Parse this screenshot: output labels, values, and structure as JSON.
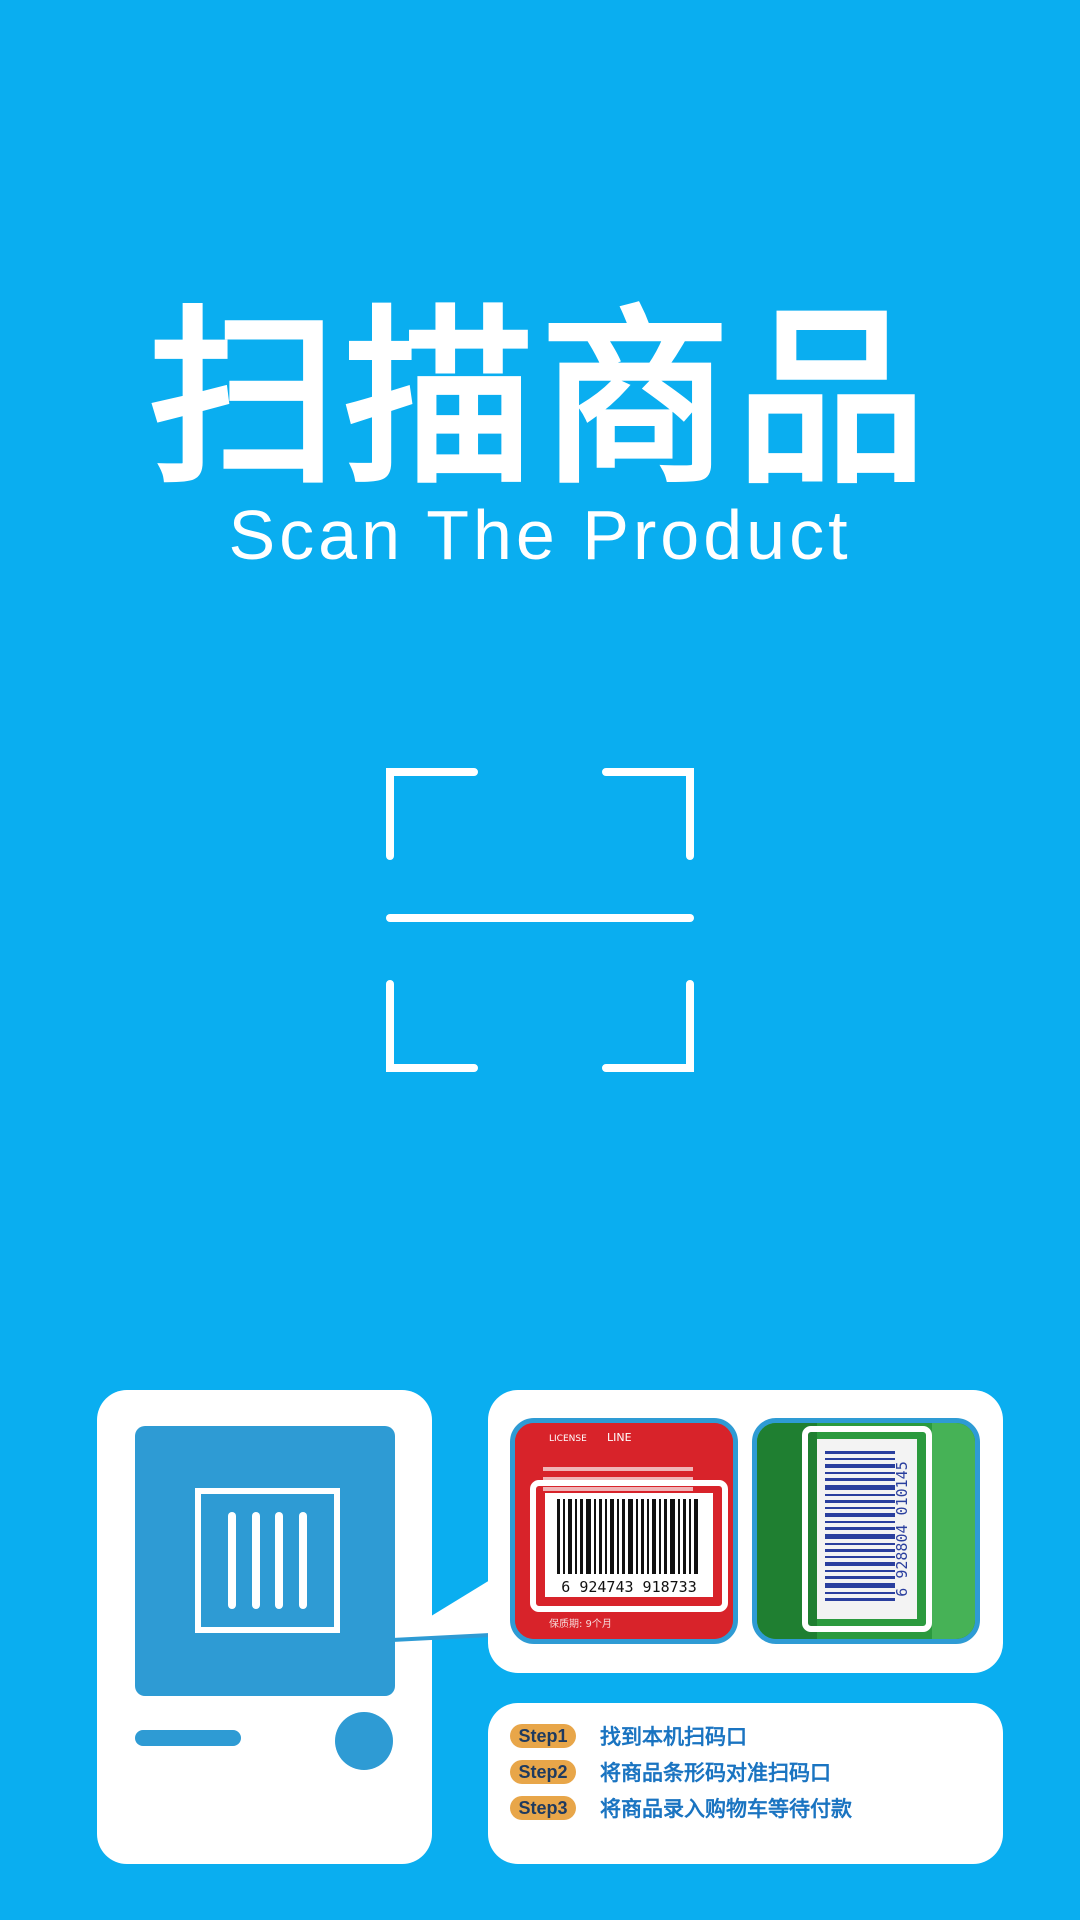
{
  "hero": {
    "title_cn": "扫描商品",
    "title_en": "Scan The Product"
  },
  "photos": {
    "red": {
      "top_logo_text": "LICENSE",
      "top_brand_text": "LINE",
      "barcode_number": "6 924743 918733",
      "footer_text": "保质期: 9个月"
    },
    "green": {
      "barcode_number": "6 928804 010145"
    }
  },
  "steps": [
    {
      "badge": "Step1",
      "text": "找到本机扫码口"
    },
    {
      "badge": "Step2",
      "text": "将商品条形码对准扫码口"
    },
    {
      "badge": "Step3",
      "text": "将商品录入购物车等待付款"
    }
  ],
  "colors": {
    "background": "#0aaef0",
    "device_blue": "#2e9bd4",
    "badge": "#e8a649",
    "step_text": "#1a74c1",
    "white": "#ffffff"
  },
  "icons": {
    "scan_frame": "scan-frame-icon",
    "barcode": "barcode-icon"
  }
}
